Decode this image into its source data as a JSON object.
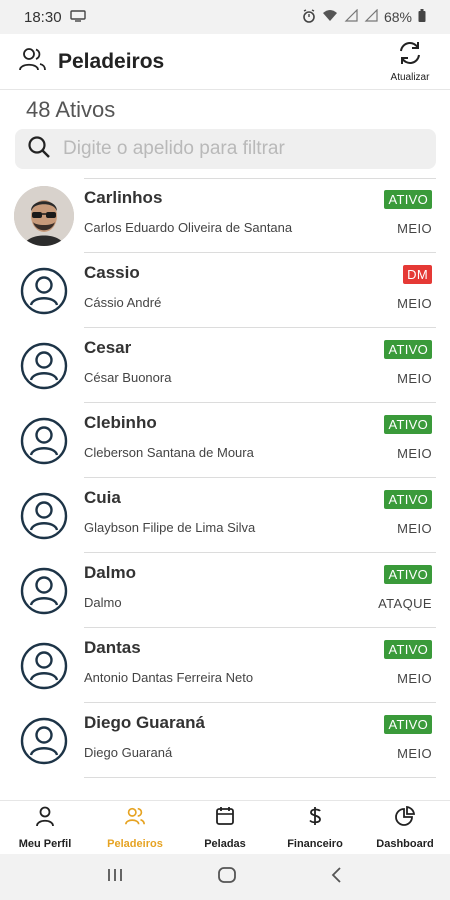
{
  "status_bar": {
    "time": "18:30",
    "battery": "68%"
  },
  "header": {
    "title": "Peladeiros",
    "refresh_label": "Atualizar"
  },
  "count_label": "48 Ativos",
  "search": {
    "placeholder": "Digite o apelido para filtrar",
    "value": ""
  },
  "colors": {
    "ativo": "#3a9a3a",
    "dm": "#e53935",
    "active_nav": "#e6a322"
  },
  "players": [
    {
      "nickname": "Carlinhos",
      "fullname": "Carlos Eduardo Oliveira de Santana",
      "status": "ATIVO",
      "status_type": "ativo",
      "position": "MEIO",
      "photo": true
    },
    {
      "nickname": "Cassio",
      "fullname": "Cássio André",
      "status": "DM",
      "status_type": "dm",
      "position": "MEIO",
      "photo": false
    },
    {
      "nickname": "Cesar",
      "fullname": "César Buonora",
      "status": "ATIVO",
      "status_type": "ativo",
      "position": "MEIO",
      "photo": false
    },
    {
      "nickname": "Clebinho",
      "fullname": "Cleberson Santana de Moura",
      "status": "ATIVO",
      "status_type": "ativo",
      "position": "MEIO",
      "photo": false
    },
    {
      "nickname": "Cuia",
      "fullname": "Glaybson Filipe de Lima Silva",
      "status": "ATIVO",
      "status_type": "ativo",
      "position": "MEIO",
      "photo": false
    },
    {
      "nickname": "Dalmo",
      "fullname": "Dalmo",
      "status": "ATIVO",
      "status_type": "ativo",
      "position": "ATAQUE",
      "photo": false
    },
    {
      "nickname": "Dantas",
      "fullname": "Antonio Dantas Ferreira Neto",
      "status": "ATIVO",
      "status_type": "ativo",
      "position": "MEIO",
      "photo": false
    },
    {
      "nickname": "Diego Guaraná",
      "fullname": "Diego Guaraná",
      "status": "ATIVO",
      "status_type": "ativo",
      "position": "MEIO",
      "photo": false
    }
  ],
  "bottom_nav": [
    {
      "label": "Meu Perfil",
      "icon": "person-icon",
      "active": false
    },
    {
      "label": "Peladeiros",
      "icon": "people-icon",
      "active": true
    },
    {
      "label": "Peladas",
      "icon": "calendar-icon",
      "active": false
    },
    {
      "label": "Financeiro",
      "icon": "dollar-icon",
      "active": false
    },
    {
      "label": "Dashboard",
      "icon": "pie-chart-icon",
      "active": false
    }
  ]
}
